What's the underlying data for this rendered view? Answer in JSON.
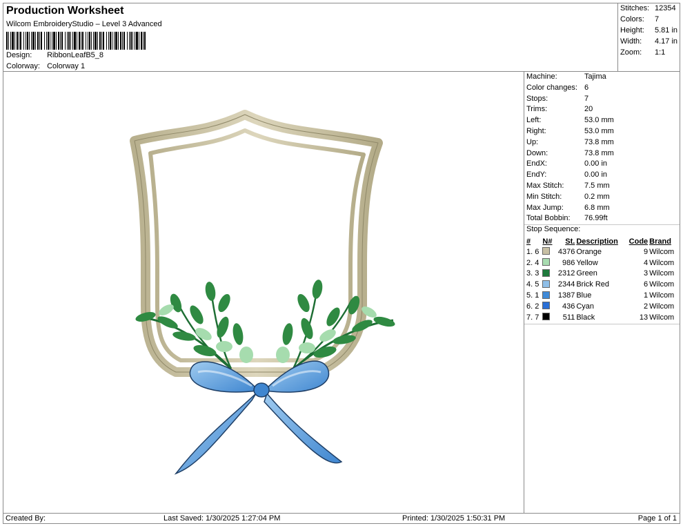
{
  "header": {
    "title": "Production Worksheet",
    "subtitle": "Wilcom EmbroideryStudio – Level 3 Advanced",
    "design_label": "Design:",
    "design_value": "RibbonLeafB5_8",
    "colorway_label": "Colorway:",
    "colorway_value": "Colorway 1"
  },
  "stats": [
    {
      "label": "Stitches:",
      "value": "12354"
    },
    {
      "label": "Colors:",
      "value": "7"
    },
    {
      "label": "Height:",
      "value": "5.81 in"
    },
    {
      "label": "Width:",
      "value": "4.17 in"
    },
    {
      "label": "Zoom:",
      "value": "1:1"
    }
  ],
  "machine_info": [
    {
      "label": "Machine:",
      "value": "Tajima"
    },
    {
      "label": "Color changes:",
      "value": "6"
    },
    {
      "label": "Stops:",
      "value": "7"
    },
    {
      "label": "Trims:",
      "value": "20"
    },
    {
      "label": "Left:",
      "value": "53.0 mm"
    },
    {
      "label": "Right:",
      "value": "53.0 mm"
    },
    {
      "label": "Up:",
      "value": "73.8 mm"
    },
    {
      "label": "Down:",
      "value": "73.8 mm"
    },
    {
      "label": "EndX:",
      "value": "0.00 in"
    },
    {
      "label": "EndY:",
      "value": "0.00 in"
    },
    {
      "label": "Max Stitch:",
      "value": "7.5 mm"
    },
    {
      "label": "Min Stitch:",
      "value": "0.2 mm"
    },
    {
      "label": "Max Jump:",
      "value": "6.8 mm"
    },
    {
      "label": "Total Bobbin:",
      "value": "76.99ft"
    }
  ],
  "stop_sequence": {
    "title": "Stop Sequence:",
    "headers": [
      "#",
      "N#",
      "St.",
      "Description",
      "Code",
      "Brand"
    ],
    "rows": [
      {
        "idx": "1.",
        "n": "6",
        "color": "#c8c0a4",
        "st": "4376",
        "desc": "Orange",
        "code": "9",
        "brand": "Wilcom"
      },
      {
        "idx": "2.",
        "n": "4",
        "color": "#a8dcb0",
        "st": "986",
        "desc": "Yellow",
        "code": "4",
        "brand": "Wilcom"
      },
      {
        "idx": "3.",
        "n": "3",
        "color": "#1e7a3c",
        "st": "2312",
        "desc": "Green",
        "code": "3",
        "brand": "Wilcom"
      },
      {
        "idx": "4.",
        "n": "5",
        "color": "#8fbfe8",
        "st": "2344",
        "desc": "Brick Red",
        "code": "6",
        "brand": "Wilcom"
      },
      {
        "idx": "5.",
        "n": "1",
        "color": "#3f8ad8",
        "st": "1387",
        "desc": "Blue",
        "code": "1",
        "brand": "Wilcom"
      },
      {
        "idx": "6.",
        "n": "2",
        "color": "#2a6fd6",
        "st": "436",
        "desc": "Cyan",
        "code": "2",
        "brand": "Wilcom"
      },
      {
        "idx": "7.",
        "n": "7",
        "color": "#000000",
        "st": "511",
        "desc": "Black",
        "code": "13",
        "brand": "Wilcom"
      }
    ]
  },
  "footer": {
    "created": "Created By:",
    "saved": "Last Saved: 1/30/2025 1:27:04 PM",
    "printed": "Printed: 1/30/2025 1:50:31 PM",
    "page": "Page 1 of 1"
  }
}
